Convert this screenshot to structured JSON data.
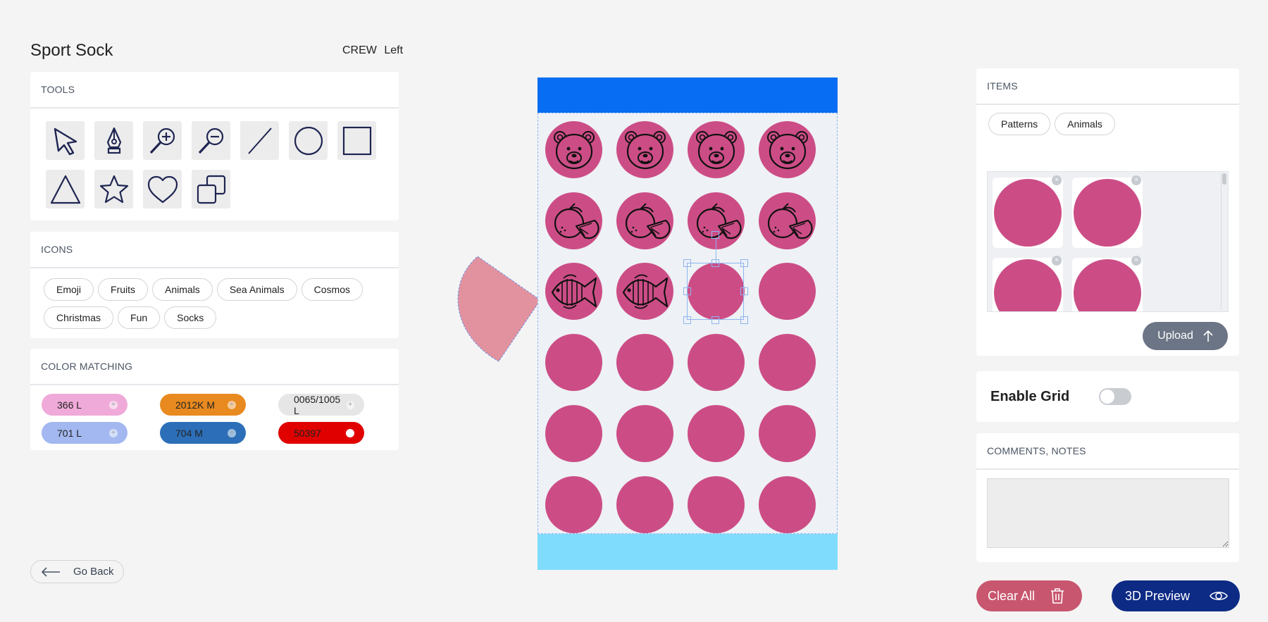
{
  "app": {
    "title": "Sport Sock",
    "style": "CREW",
    "side": "Left"
  },
  "tools": {
    "heading": "TOOLS",
    "items": [
      "select-arrow",
      "pen",
      "zoom-in",
      "zoom-out",
      "line",
      "ellipse",
      "rectangle",
      "triangle",
      "star",
      "heart",
      "duplicate"
    ]
  },
  "icons": {
    "heading": "ICONS",
    "categories": [
      "Emoji",
      "Fruits",
      "Animals",
      "Sea Animals",
      "Cosmos",
      "Christmas",
      "Fun",
      "Socks"
    ]
  },
  "color_matching": {
    "heading": "COLOR MATCHING",
    "swatches": [
      {
        "label": "366 L",
        "color": "#f0aad9"
      },
      {
        "label": "2012K M",
        "color": "#e88a1f"
      },
      {
        "label": "0065/1005 L",
        "color": "#e6e6e6"
      },
      {
        "label": "701 L",
        "color": "#a3b8f0"
      },
      {
        "label": "704 M",
        "color": "#2c6fb8"
      },
      {
        "label": "50397",
        "color": "#e00000"
      }
    ]
  },
  "go_back": {
    "label": "Go Back"
  },
  "canvas": {
    "top_band_color": "#076df2",
    "bottom_band_color": "#80dcfd",
    "circle_color": "#cc4d86",
    "rows": [
      [
        "bear",
        "bear",
        "bear",
        "bear"
      ],
      [
        "orange",
        "orange",
        "orange",
        "orange"
      ],
      [
        "fish",
        "fish",
        "empty",
        "empty"
      ],
      [
        "empty",
        "empty",
        "empty",
        "empty"
      ],
      [
        "empty",
        "empty",
        "empty",
        "empty"
      ],
      [
        "empty",
        "empty",
        "empty",
        "empty"
      ]
    ]
  },
  "items": {
    "heading": "ITEMS",
    "tabs": [
      "Patterns",
      "Animals"
    ],
    "upload_label": "Upload"
  },
  "grid": {
    "label": "Enable Grid",
    "enabled": false
  },
  "notes": {
    "heading": "COMMENTS, NOTES",
    "value": ""
  },
  "actions": {
    "clear_label": "Clear All",
    "preview_label": "3D Preview"
  }
}
